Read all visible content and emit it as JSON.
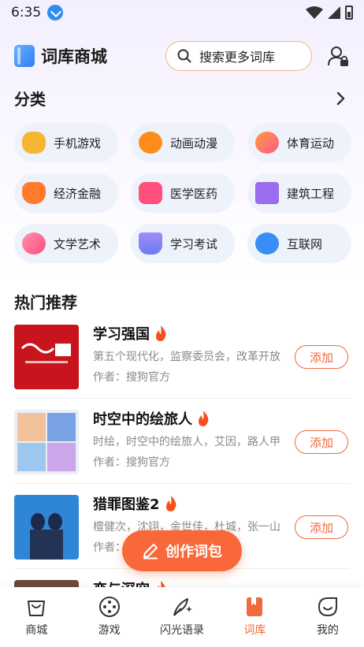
{
  "status": {
    "time": "6:35"
  },
  "header": {
    "title": "词库商城",
    "search_placeholder": "搜索更多词库"
  },
  "categories_section": {
    "title": "分类",
    "items": [
      {
        "label": "手机游戏",
        "icon": "gamepad-icon",
        "color": "#f7b631"
      },
      {
        "label": "动画动漫",
        "icon": "film-reel-icon",
        "color": "#ff8c1a"
      },
      {
        "label": "体育运动",
        "icon": "sport-ball-icon",
        "color": "#ff6a8a"
      },
      {
        "label": "经济金融",
        "icon": "money-bag-icon",
        "color": "#ff7a2a"
      },
      {
        "label": "医学医药",
        "icon": "medical-kit-icon",
        "color": "#ff4f7a"
      },
      {
        "label": "建筑工程",
        "icon": "building-icon",
        "color": "#9b6cf0"
      },
      {
        "label": "文学艺术",
        "icon": "palette-icon",
        "color": "#ff5b8c"
      },
      {
        "label": "学习考试",
        "icon": "graduation-cap-icon",
        "color": "#6b7cf0"
      },
      {
        "label": "互联网",
        "icon": "globe-icon",
        "color": "#3a8df5"
      }
    ]
  },
  "recommend_section": {
    "title": "热门推荐",
    "items": [
      {
        "name": "学习强国",
        "desc": "第五个现代化，监察委员会，改革开放",
        "author": "作者：搜狗官方",
        "add": "添加"
      },
      {
        "name": "时空中的绘旅人",
        "desc": "时绘，时空中的绘旅人，艾因，路人甲",
        "author": "作者：搜狗官方",
        "add": "添加"
      },
      {
        "name": "猎罪图鉴2",
        "desc": "檀健次，沈翊，金世佳，杜城，张一山",
        "author": "作者：",
        "add": "添加"
      },
      {
        "name": "恋与深空",
        "desc": "",
        "author": "",
        "add": ""
      }
    ]
  },
  "fab": {
    "label": "创作词包"
  },
  "tabbar": {
    "items": [
      {
        "label": "商城",
        "icon": "shop-bag-icon",
        "active": false
      },
      {
        "label": "游戏",
        "icon": "game-controller-icon",
        "active": false
      },
      {
        "label": "闪光语录",
        "icon": "quill-sparkle-icon",
        "active": false
      },
      {
        "label": "词库",
        "icon": "wordbook-icon",
        "active": true
      },
      {
        "label": "我的",
        "icon": "profile-face-icon",
        "active": false
      }
    ]
  },
  "colors": {
    "accent": "#f06a3c",
    "fab": "#f9683a",
    "pill_bg": "#eef2fb"
  }
}
